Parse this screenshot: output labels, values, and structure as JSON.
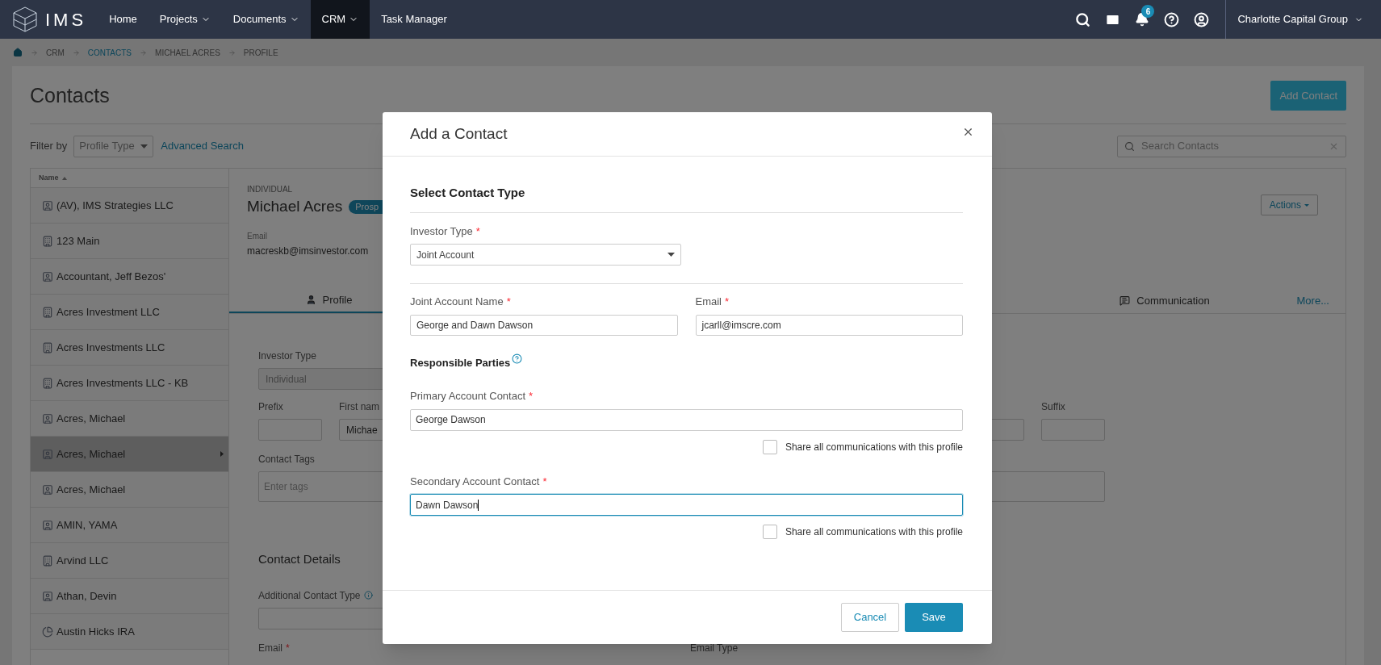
{
  "nav": {
    "logo_text": "IMS",
    "items": [
      {
        "label": "Home",
        "dropdown": false,
        "selected": false
      },
      {
        "label": "Projects",
        "dropdown": true,
        "selected": false
      },
      {
        "label": "Documents",
        "dropdown": true,
        "selected": false
      },
      {
        "label": "CRM",
        "dropdown": true,
        "selected": true
      },
      {
        "label": "Task Manager",
        "dropdown": false,
        "selected": false
      }
    ],
    "notification_count": "6",
    "account": "Charlotte Capital Group"
  },
  "breadcrumb": [
    {
      "label": "CRM",
      "link": false
    },
    {
      "label": "CONTACTS",
      "link": true
    },
    {
      "label": "MICHAEL ACRES",
      "link": false
    },
    {
      "label": "PROFILE",
      "link": false
    }
  ],
  "page": {
    "title": "Contacts",
    "add_button": "Add Contact",
    "filter_label": "Filter by",
    "filter_select": "Profile Type",
    "advanced_search": "Advanced Search",
    "search_placeholder": "Search Contacts"
  },
  "table": {
    "column": "Name",
    "rows": [
      {
        "name": "(AV), IMS Strategies LLC",
        "kind": "person",
        "selected": false
      },
      {
        "name": "123 Main",
        "kind": "company",
        "selected": false
      },
      {
        "name": "Accountant, Jeff Bezos'",
        "kind": "person",
        "selected": false
      },
      {
        "name": "Acres Investment LLC",
        "kind": "company",
        "selected": false
      },
      {
        "name": "Acres Investments LLC",
        "kind": "company",
        "selected": false
      },
      {
        "name": "Acres Investments LLC - KB",
        "kind": "company",
        "selected": false
      },
      {
        "name": "Acres, Michael",
        "kind": "person",
        "selected": false
      },
      {
        "name": "Acres, Michael",
        "kind": "person",
        "selected": true
      },
      {
        "name": "Acres, Michael",
        "kind": "person",
        "selected": false
      },
      {
        "name": "AMIN, YAMA",
        "kind": "person",
        "selected": false
      },
      {
        "name": "Arvind LLC",
        "kind": "company",
        "selected": false
      },
      {
        "name": "Athan, Devin",
        "kind": "person",
        "selected": false
      },
      {
        "name": "Austin Hicks IRA",
        "kind": "trust",
        "selected": false
      }
    ]
  },
  "profile": {
    "type": "INDIVIDUAL",
    "name": "Michael Acres",
    "badge": "Prosp",
    "email_label": "Email",
    "email": "macreskb@imsinvestor.com",
    "actions": "Actions",
    "tabs": [
      {
        "label": "Profile",
        "kind": "person",
        "selected": true
      },
      {
        "label": "Communication",
        "kind": "message",
        "selected": false
      }
    ],
    "more": "More...",
    "form": {
      "investor_type_label": "Investor Type",
      "investor_type": "Individual",
      "prefix_label": "Prefix",
      "first_name_label": "First nam",
      "first_name": "Michae",
      "suffix_label": "Suffix",
      "tags_label": "Contact Tags",
      "tags_placeholder": "Enter tags",
      "section": "Contact Details",
      "additional_type_label": "Additional Contact Type",
      "email_label": {
        "text": "Email",
        "mark": "*"
      },
      "email_type_label": "Email Type"
    }
  },
  "modal": {
    "title": "Add a Contact",
    "section": "Select Contact Type",
    "investor_type_label": {
      "text": "Investor Type",
      "mark": "*"
    },
    "investor_type": "Joint Account",
    "joint_name_label": {
      "text": "Joint Account Name",
      "mark": "*"
    },
    "joint_name": "George and Dawn Dawson",
    "email_label": {
      "text": "Email",
      "mark": "*"
    },
    "email": "jcarll@imscre.com",
    "parties_title": "Responsible Parties",
    "contacts": [
      {
        "label": {
          "text": "Primary Account Contact",
          "mark": "*"
        },
        "value": "George Dawson",
        "focused": false,
        "share": {
          "label": "Share all communications with this profile",
          "checked": false
        }
      },
      {
        "label": {
          "text": "Secondary Account Contact",
          "mark": "*"
        },
        "value": "Dawn Dawson",
        "focused": true,
        "share": {
          "label": "Share all communications with this profile",
          "checked": false
        }
      }
    ],
    "cancel": "Cancel",
    "save": "Save"
  }
}
